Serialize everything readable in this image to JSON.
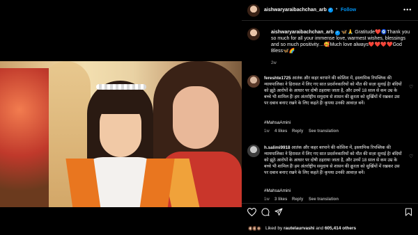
{
  "post": {
    "username": "aishwaryaraibachchan_arb",
    "follow_label": "Follow",
    "more_label": "•••"
  },
  "caption": {
    "username": "aishwaryaraibachchan_arb",
    "text": " 🦋🙏 Gratitude❤️🧿Thank you so much for all your immense love, warmest wishes, blessings and so much positivity…🥰Much love always❤️❤️❤️❤️God Bless🦋🌈",
    "time": "2w"
  },
  "comments": [
    {
      "username": "fereshte1725",
      "text": " आतंक और कहर बरपाने की कोशिश में, इस्लामिक रिपब्लिक की न्यायपालिका ने हिरासत में लिए गए सात प्रदर्शनकारियों को मौत की सज़ा सुनाई है! बंदियों को झूठे आरोपों के आधार पर दोषी ठहराया जाता है, और उनमें 18 साल से कम उम्र के बच्चे भी शामिल हैं! हम अंतर्राष्ट्रीय समुदाय से शासन की क्रूरता को सुर्खियों में रखकर उस पर दबाव बनाए रखने के लिए कहते हैं! कृपया उनकी आवाज़ बनें।",
      "hashtag": "#MahsaAmini",
      "time": "1w",
      "likes": "4 likes",
      "reply": "Reply",
      "translate": "See translation"
    },
    {
      "username": "h.salimi9918",
      "text": " आतंक और कहर बरपाने की कोशिश में, इस्लामिक रिपब्लिक की न्यायपालिका ने हिरासत में लिए गए सात प्रदर्शनकारियों को मौत की सज़ा सुनाई है! बंदियों को झूठे आरोपों के आधार पर दोषी ठहराया जाता है, और उनमें 18 साल से कम उम्र के बच्चे भी शामिल हैं! हम अंतर्राष्ट्रीय समुदाय से शासन की क्रूरता को सुर्खियों में रखकर उस पर दबाव बनाए रखने के लिए कहते हैं! कृपया उनकी आवाज़ बनें।",
      "hashtag": "#MahsaAmini",
      "time": "1w",
      "likes": "3 likes",
      "reply": "Reply",
      "translate": "See translation"
    }
  ],
  "actions": {
    "liked_by_prefix": "Liked by ",
    "liked_by_user": "rautelaurvashi",
    "liked_by_middle": " and ",
    "liked_by_count": "605,414 others"
  },
  "colors": {
    "follow": "#0095f6",
    "heart": "#ed4956"
  }
}
